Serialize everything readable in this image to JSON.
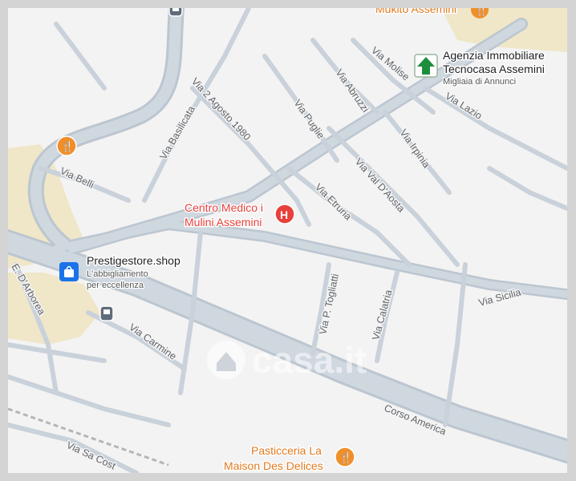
{
  "map": {
    "watermark": "casa.it",
    "colors": {
      "background": "#f3f3f3",
      "road_casing": "#bcc6d0",
      "road_fill": "#cfd7df",
      "park": "#f0e6c8",
      "medical_red": "#e8403b",
      "food_orange": "#f08f2a",
      "shop_blue": "#1a73e8",
      "agency_green": "#1e8e3e",
      "transit_slate": "#5f6b7a"
    },
    "streets": {
      "via_2_agosto": "Via 2 Agosto 1980",
      "via_basilicata": "Via Basilicata",
      "via_molise": "Via Molise",
      "via_abruzzi": "Via Abruzzi",
      "via_lazio": "Via Lazio",
      "via_puglie": "Via Puglie",
      "via_irpinia": "Via Irpinia",
      "via_val_daosta": "Via Val D'Aosta",
      "via_etruria": "Via Etruria",
      "via_belli": "Via Belli",
      "e_darborea": "E. D'Arborea",
      "via_sicilia": "Via Sicilia",
      "via_p_togliatti": "Via P. Togliatti",
      "via_calatria": "Via Calatria",
      "via_carmine": "Via Carmine",
      "corso_america": "Corso America",
      "via_sa_costa": "Via Sa Cost"
    },
    "pois": {
      "mukito": {
        "title": "Mukito Assemini",
        "icon": "restaurant-icon"
      },
      "agency": {
        "title_line1": "Agenzia Immobiliare",
        "title_line2": "Tecnocasa Assemini",
        "subtitle": "Migliaia di Annunci",
        "icon": "real-estate-icon"
      },
      "medical": {
        "title_line1": "Centro Medico i",
        "title_line2": "Mulini Assemini",
        "icon": "hospital-icon"
      },
      "prestige": {
        "title": "Prestigestore.shop",
        "subtitle_line1": "L'abbigliamento",
        "subtitle_line2": "per eccellenza",
        "icon": "shopping-bag-icon"
      },
      "pasticceria": {
        "title_line1": "Pasticceria La",
        "title_line2": "Maison Des Delices",
        "icon": "restaurant-icon"
      },
      "restaurant_west": {
        "icon": "restaurant-icon"
      },
      "bus_stop": {
        "icon": "bus-stop-icon"
      },
      "bus_top": {
        "icon": "bus-stop-icon"
      }
    }
  }
}
